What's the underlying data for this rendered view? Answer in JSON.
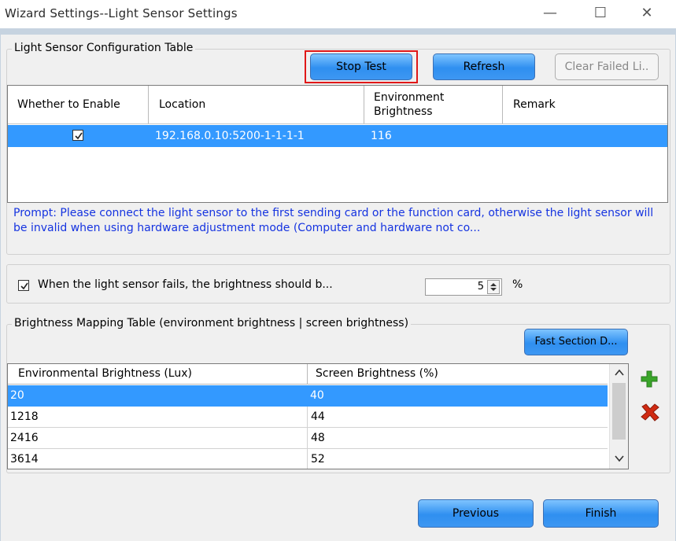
{
  "window": {
    "title": "Wizard Settings--Light Sensor Settings",
    "minimize_glyph": "—",
    "maximize_glyph": "☐",
    "close_glyph": "✕"
  },
  "sensor_group": {
    "legend": "Light Sensor Configuration Table",
    "buttons": {
      "stop_test": "Stop Test",
      "refresh": "Refresh",
      "clear_failed": "Clear Failed Li.."
    },
    "columns": [
      "Whether to Enable",
      "Location",
      "Environment Brightness",
      "Remark"
    ],
    "rows": [
      {
        "enabled": true,
        "location": "192.168.0.10:5200-1-1-1-1",
        "brightness": "116",
        "remark": ""
      }
    ],
    "prompt": "Prompt: Please connect the light sensor to the first sending card or the function card, otherwise the light sensor will be invalid when using hardware adjustment mode (Computer and hardware not co..."
  },
  "fail_group": {
    "checked": true,
    "label": "When the light sensor fails, the brightness should b...",
    "value": "5",
    "unit": "%"
  },
  "mapping_group": {
    "legend": "Brightness Mapping Table (environment brightness | screen brightness)",
    "fast_button": "Fast Section D...",
    "columns": [
      "Environmental Brightness (Lux)",
      "Screen Brightness (%)"
    ],
    "rows": [
      {
        "env": "20",
        "screen": "40"
      },
      {
        "env": "1218",
        "screen": "44"
      },
      {
        "env": "2416",
        "screen": "48"
      },
      {
        "env": "3614",
        "screen": "52"
      }
    ]
  },
  "footer": {
    "previous": "Previous",
    "finish": "Finish"
  },
  "colors": {
    "selection": "#3399ff",
    "prompt": "#1533e0",
    "highlight": "#e01818",
    "button": "#2f8ff0"
  }
}
